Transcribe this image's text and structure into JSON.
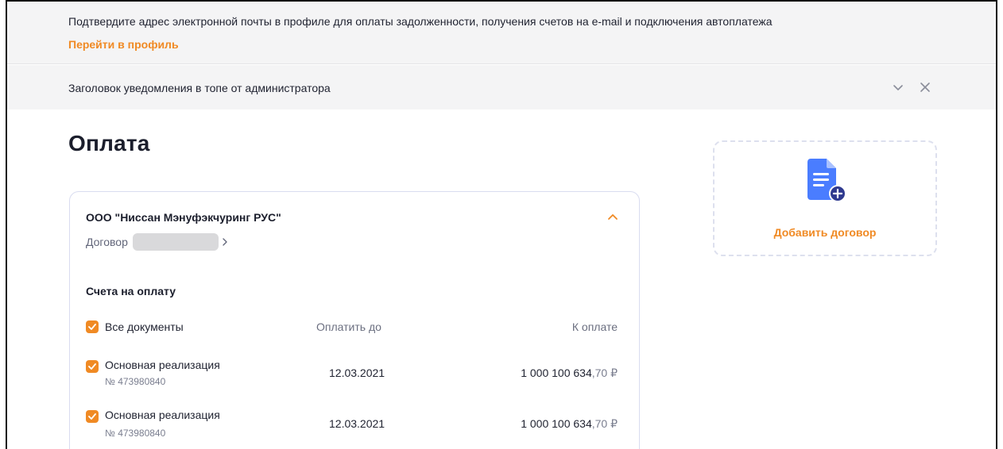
{
  "notice": {
    "message": "Подтвердите адрес электронной почты в профиле для оплаты задолженности, получения счетов на e-mail и подключения автоплатежа",
    "link_label": "Перейти в профиль",
    "link_color": "#f08a24"
  },
  "admin_banner": {
    "title": "Заголовок уведомления в топе от администратора",
    "expand_icon": "chevron-down-icon",
    "close_icon": "close-icon"
  },
  "page": {
    "title": "Оплата"
  },
  "contract_card": {
    "company": "ООО \"Ниссан Мэнуфэкчуринг РУС\"",
    "contract_label": "Договор",
    "section_title": "Счета на оплату",
    "columns": {
      "all_documents": "Все документы",
      "due_date": "Оплатить до",
      "amount": "К оплате"
    },
    "all_checked": true,
    "invoices": [
      {
        "name": "Основная реализация",
        "number": "№ 473980840",
        "due_date": "12.03.2021",
        "amount_main": "1 000 100 634",
        "amount_kop": ",70 ₽",
        "checked": true
      },
      {
        "name": "Основная реализация",
        "number": "№ 473980840",
        "due_date": "12.03.2021",
        "amount_main": "1 000 100 634",
        "amount_kop": ",70 ₽",
        "checked": true
      }
    ]
  },
  "add_contract": {
    "label": "Добавить договор",
    "icon": "document-add-icon"
  },
  "colors": {
    "accent": "#f08a24",
    "icon_blue": "#4a7dff",
    "banner_bg": "#f4f4f5"
  }
}
